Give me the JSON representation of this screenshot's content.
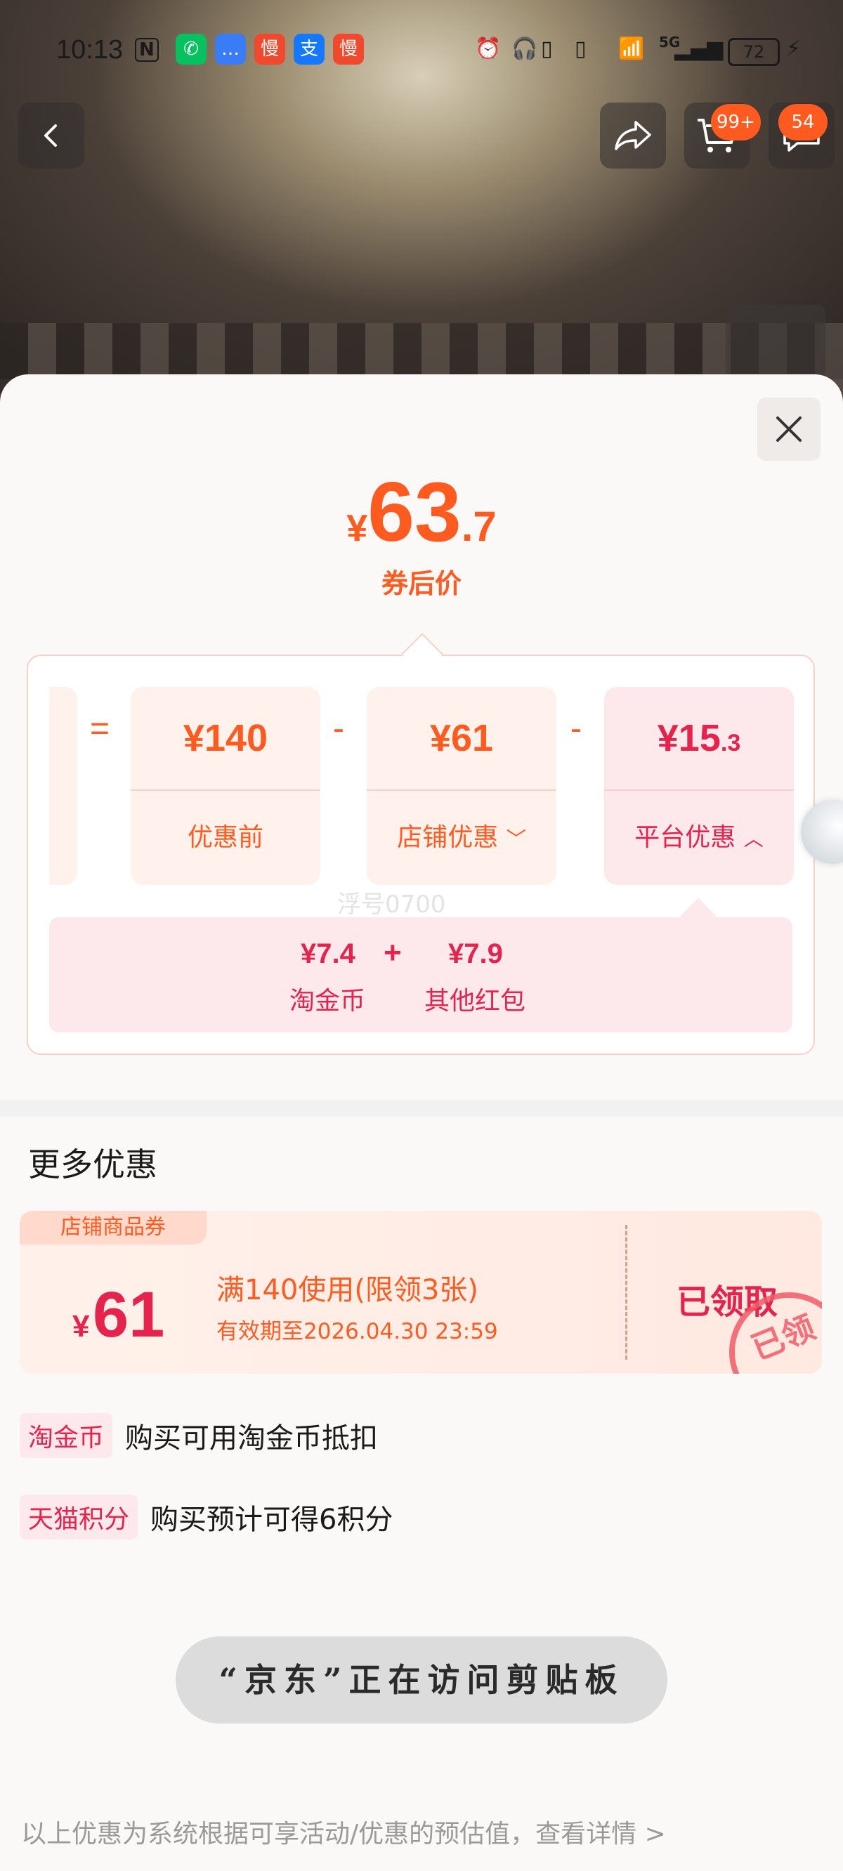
{
  "status_bar": {
    "time": "10:13",
    "nfc": "N",
    "apps": [
      {
        "name": "wechat",
        "glyph": "✆",
        "color": "#07c160"
      },
      {
        "name": "message",
        "glyph": "…",
        "color": "#3a7cf5"
      },
      {
        "name": "slow-1",
        "glyph": "慢",
        "color": "#f04a2e"
      },
      {
        "name": "alipay",
        "glyph": "支",
        "color": "#1677ff"
      },
      {
        "name": "slow-2",
        "glyph": "慢",
        "color": "#f04a2e"
      }
    ],
    "signal_label": "5G",
    "battery": "72"
  },
  "topbar": {
    "cart_badge": "99+",
    "msg_badge": "54"
  },
  "price": {
    "currency": "¥",
    "integer": "63",
    "decimal": ".7",
    "label": "券后价"
  },
  "breakdown": {
    "equals": "=",
    "minus": "-",
    "before": {
      "value": "¥140",
      "label": "优惠前"
    },
    "shop": {
      "value": "¥61",
      "label": "店铺优惠"
    },
    "platform": {
      "value_int": "¥15",
      "value_dec": ".3",
      "label": "平台优惠"
    },
    "sub": {
      "plus": "+",
      "items": [
        {
          "value": "¥7.4",
          "label": "淘金币"
        },
        {
          "value": "¥7.9",
          "label": "其他红包"
        }
      ]
    }
  },
  "watermark": "浮号0700",
  "more": {
    "title": "更多优惠",
    "coupon": {
      "tag": "店铺商品券",
      "currency": "¥",
      "amount": "61",
      "condition": "满140使用(限领3张)",
      "expiry": "有效期至2026.04.30 23:59",
      "status": "已领取",
      "stamp": "已领"
    },
    "lines": [
      {
        "tag": "淘金币",
        "text": "购买可用淘金币抵扣"
      },
      {
        "tag": "天猫积分",
        "text": "购买预计可得6积分"
      }
    ]
  },
  "toast": "“京东”正在访问剪贴板",
  "footer": "以上优惠为系统根据可享活动/优惠的预估值，查看详情 >"
}
